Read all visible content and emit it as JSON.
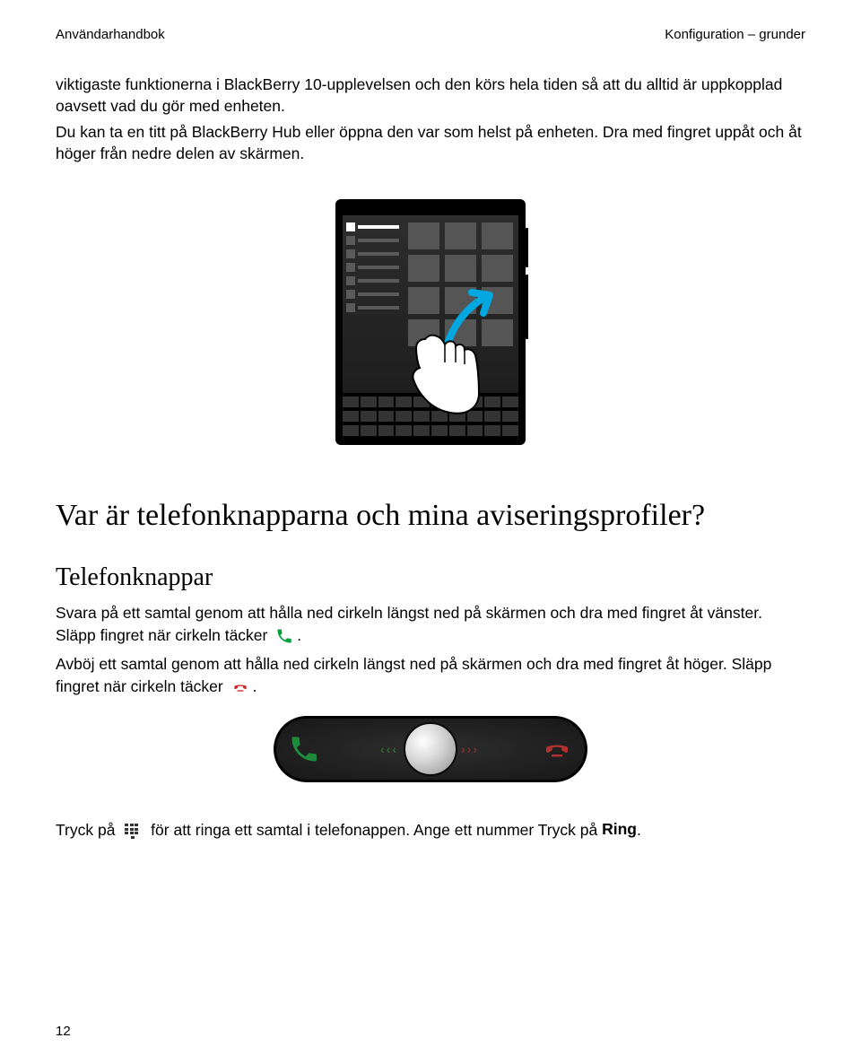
{
  "header": {
    "left": "Användarhandbok",
    "right": "Konfiguration – grunder"
  },
  "intro": {
    "p1": "viktigaste funktionerna i BlackBerry 10-upplevelsen och den körs hela tiden så att du alltid är uppkopplad oavsett vad du gör med enheten.",
    "p2": "Du kan ta en titt på BlackBerry Hub eller öppna den var som helst på enheten. Dra med fingret uppåt och åt höger från nedre delen av skärmen."
  },
  "section": {
    "h1": "Var är telefonknapparna och mina aviseringsprofiler?",
    "h2": "Telefonknappar",
    "answer_a": "Svara på ett samtal genom att hålla ned cirkeln längst ned på skärmen och dra med fingret åt vänster. Släpp fingret när cirkeln täcker ",
    "answer_b": ".",
    "decline_a": "Avböj ett samtal genom att hålla ned cirkeln längst ned på skärmen och dra med fingret åt höger. Släpp fingret när cirkeln täcker ",
    "decline_b": "."
  },
  "footer_line": {
    "a": "Tryck på ",
    "b": " för att ringa ett samtal i telefonappen. Ange ett nummer Tryck på ",
    "bold": "Ring",
    "c": "."
  },
  "page_number": "12",
  "icons": {
    "swipe_arrow": "swipe-up-right-arrow-icon",
    "hand": "hand-pointer-icon",
    "answer": "phone-answer-icon",
    "decline": "phone-hangup-icon",
    "dialpad": "dialpad-icon",
    "slider_answer": "slider-answer-phone-icon",
    "slider_decline": "slider-decline-phone-icon"
  },
  "colors": {
    "arrow": "#00A7E0",
    "answer_green": "#00a13a",
    "decline_red": "#d62424"
  }
}
